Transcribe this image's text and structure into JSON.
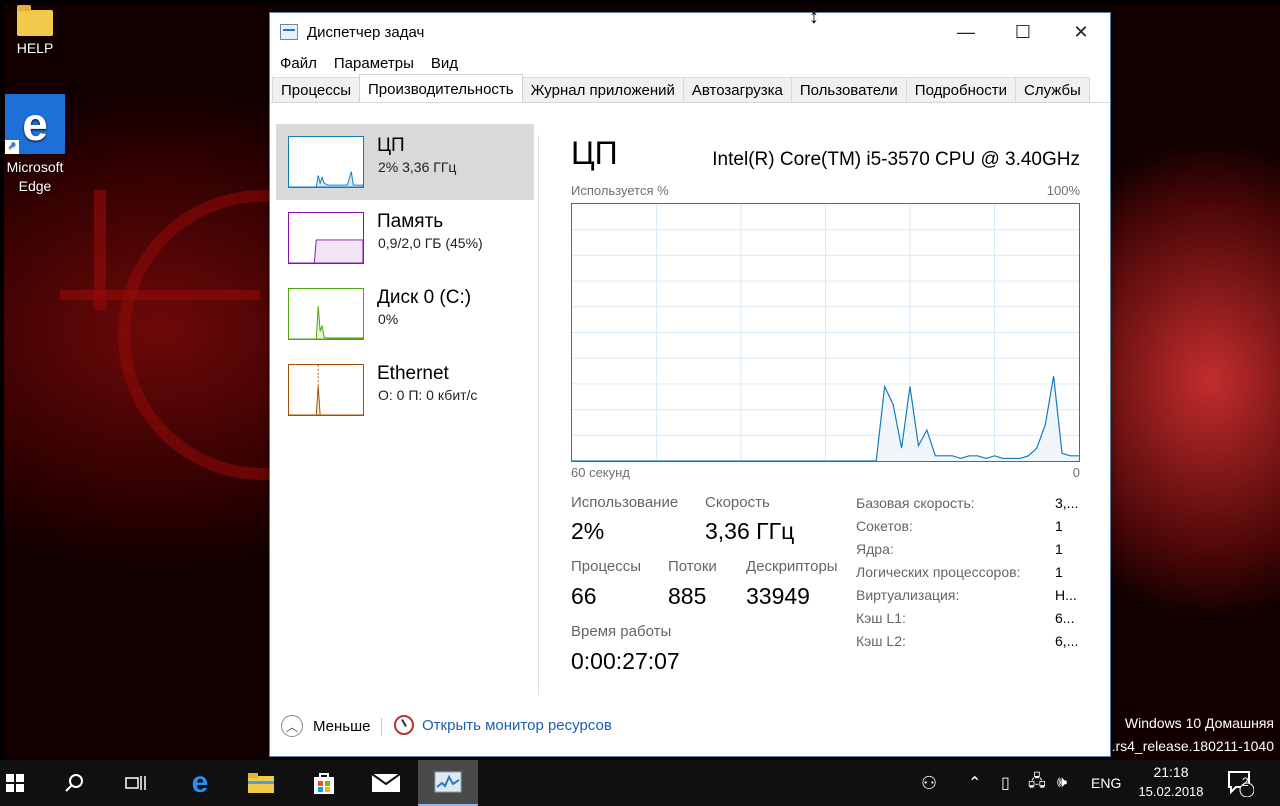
{
  "desktop": {
    "icons": [
      {
        "label": "HELP"
      },
      {
        "label": "Microsoft Edge"
      }
    ],
    "watermark": {
      "line1": "Windows 10 Домашняя",
      "line2": ".rs4_release.180211-1040"
    }
  },
  "window": {
    "title": "Диспетчер задач",
    "controls": {
      "minimize": "—",
      "maximize": "☐",
      "close": "✕"
    },
    "menu": [
      "Файл",
      "Параметры",
      "Вид"
    ],
    "tabs": [
      "Процессы",
      "Производительность",
      "Журнал приложений",
      "Автозагрузка",
      "Пользователи",
      "Подробности",
      "Службы"
    ],
    "active_tab": "Производительность",
    "sidebar": [
      {
        "name": "ЦП",
        "sub": "2% 3,36 ГГц",
        "color": "#117dbb"
      },
      {
        "name": "Память",
        "sub": "0,9/2,0 ГБ (45%)",
        "color": "#8b12ae"
      },
      {
        "name": "Диск 0 (C:)",
        "sub": "0%",
        "color": "#4da60c"
      },
      {
        "name": "Ethernet",
        "sub": "О: 0 П: 0 кбит/с",
        "color": "#a74f01"
      }
    ],
    "main": {
      "title": "ЦП",
      "model": "Intel(R) Core(TM) i5-3570 CPU @ 3.40GHz",
      "graph_label_left": "Используется %",
      "graph_label_right": "100%",
      "axis_left": "60 секунд",
      "axis_right": "0",
      "stats": {
        "usage_label": "Использование",
        "usage_value": "2%",
        "speed_label": "Скорость",
        "speed_value": "3,36 ГГц",
        "processes_label": "Процессы",
        "processes_value": "66",
        "threads_label": "Потоки",
        "threads_value": "885",
        "handles_label": "Дескрипторы",
        "handles_value": "33949",
        "uptime_label": "Время работы",
        "uptime_value": "0:00:27:07"
      },
      "details": [
        {
          "label": "Базовая скорость:",
          "value": "3,..."
        },
        {
          "label": "Сокетов:",
          "value": "1"
        },
        {
          "label": "Ядра:",
          "value": "1"
        },
        {
          "label": "Логических процессоров:",
          "value": "1"
        },
        {
          "label": "Виртуализация:",
          "value": "Н..."
        },
        {
          "label": "Кэш L1:",
          "value": "6..."
        },
        {
          "label": "Кэш L2:",
          "value": "6,..."
        }
      ]
    },
    "footer": {
      "less": "Меньше",
      "resmon": "Открыть монитор ресурсов"
    }
  },
  "chart_data": {
    "type": "area",
    "ylim": [
      0,
      100
    ],
    "xlim": [
      60,
      0
    ],
    "x": [
      60,
      48,
      36,
      24,
      23,
      22,
      21,
      20,
      19,
      18,
      17,
      16,
      15,
      14,
      13,
      12,
      11,
      10,
      9,
      8,
      7,
      6,
      5,
      4,
      3,
      2,
      1,
      0
    ],
    "values": [
      0,
      0,
      0,
      0,
      29,
      22,
      5,
      29,
      6,
      12,
      2,
      2,
      2,
      1,
      2,
      2,
      1,
      2,
      1,
      1,
      1,
      2,
      5,
      14,
      33,
      3,
      2,
      2
    ],
    "grid": true
  },
  "taskbar": {
    "items": [
      "start",
      "search",
      "task-view",
      "edge",
      "explorer",
      "store",
      "mail",
      "task-manager"
    ],
    "lang": "ENG",
    "time": "21:18",
    "date": "15.02.2018",
    "notifications": "2"
  }
}
